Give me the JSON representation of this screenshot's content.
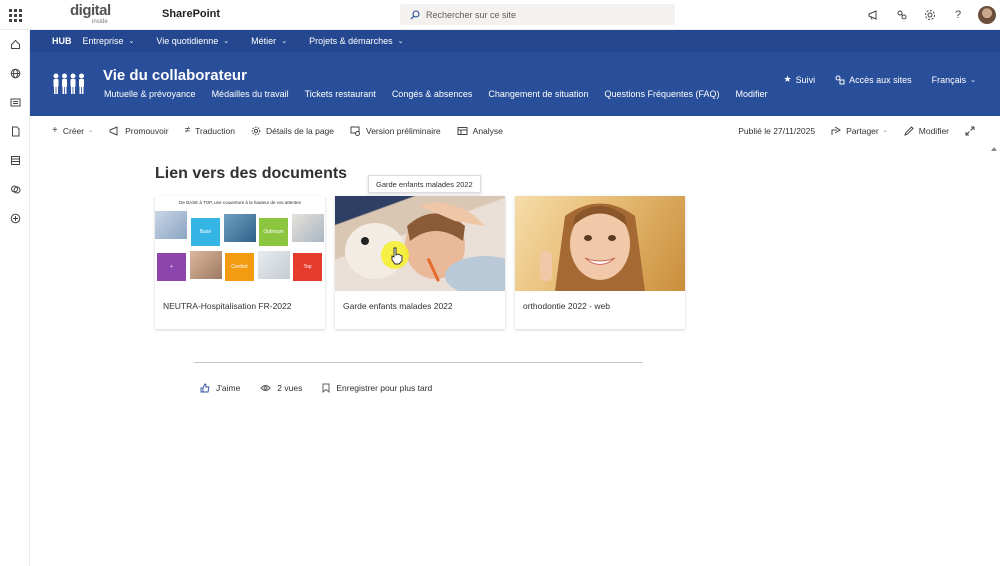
{
  "topbar": {
    "logo_text": "digital",
    "logo_subtext": "inside",
    "app_name": "SharePoint",
    "search_placeholder": "Rechercher sur ce site",
    "help_label": "?"
  },
  "hubnav": {
    "hub_label": "HUB",
    "items": [
      "Entreprise",
      "Vie quotidienne",
      "Métier",
      "Projets & démarches"
    ]
  },
  "site": {
    "title": "Vie du collaborateur",
    "nav": [
      "Mutuelle & prévoyance",
      "Médailles du travail",
      "Tickets restaurant",
      "Congés & absences",
      "Changement de situation",
      "Questions Fréquentes (FAQ)",
      "Modifier"
    ],
    "follow_label": "Suivi",
    "sites_access_label": "Accès aux sites",
    "language_label": "Français"
  },
  "commandbar": {
    "create": "Créer",
    "promote": "Promouvoir",
    "translate": "Traduction",
    "page_details": "Détails de la page",
    "preview": "Version préliminaire",
    "analytics": "Analyse",
    "published": "Publié le 27/11/2025",
    "share": "Partager",
    "edit": "Modifier"
  },
  "section": {
    "title": "Lien vers des documents",
    "tooltip": "Garde enfants malades 2022"
  },
  "documents": [
    {
      "label": "NEUTRA-Hospitalisation FR-2022"
    },
    {
      "label": "Garde enfants malades 2022"
    },
    {
      "label": "orthodontie 2022 - web"
    }
  ],
  "thumb1": {
    "heading": "De BASE à TOP, une couverture à la hauteur de vos attentes",
    "tiles": [
      "Base",
      "Optimum",
      "+",
      "Confort",
      "Top"
    ]
  },
  "social": {
    "like": "J'aime",
    "views": "2 vues",
    "save": "Enregistrer pour plus tard"
  },
  "colors": {
    "hub_bar": "#24478f",
    "site_header": "#2a4f9a",
    "tile_base": "#35b4e6",
    "tile_optimum": "#8cc63f",
    "tile_plus": "#8e44ad",
    "tile_confort": "#f39c12",
    "tile_top": "#e53c2e"
  }
}
